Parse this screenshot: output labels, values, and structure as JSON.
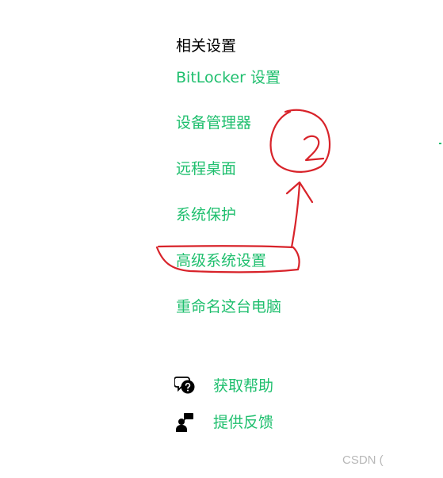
{
  "theme": {
    "accent": "#1fbf6e",
    "text": "#000000",
    "annotation": "#d8232a",
    "watermark": "#b8b8b8"
  },
  "related_settings": {
    "title": "相关设置",
    "links": [
      {
        "label": "BitLocker 设置"
      },
      {
        "label": "设备管理器"
      },
      {
        "label": "远程桌面"
      },
      {
        "label": "系统保护"
      },
      {
        "label": "高级系统设置"
      },
      {
        "label": "重命名这台电脑"
      }
    ]
  },
  "help": {
    "get_help": {
      "label": "获取帮助",
      "icon": "chat-question-icon"
    },
    "feedback": {
      "label": "提供反馈",
      "icon": "feedback-person-icon"
    }
  },
  "annotation": {
    "number": "2"
  },
  "watermark": "CSDN ("
}
